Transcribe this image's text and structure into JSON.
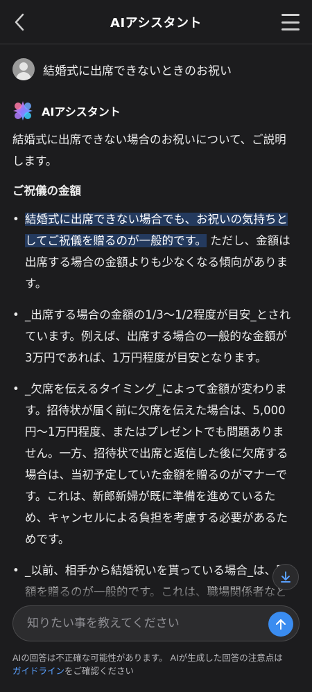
{
  "header": {
    "title": "AIアシスタント",
    "back_icon": "chevron-left-icon",
    "menu_icon": "hamburger-menu-icon"
  },
  "user": {
    "message": "結婚式に出席できないときのお祝い"
  },
  "assistant": {
    "name": "AIアシスタント",
    "intro": "結婚式に出席できない場合のお祝いについて、ご説明します。",
    "section_title": "ご祝儀の金額",
    "bullets": [
      {
        "highlighted": "結婚式に出席できない場合でも、お祝いの気持ちとしてご祝儀を贈るのが一般的です。",
        "rest": " ただし、金額は出席する場合の金額よりも少なくなる傾向があります。"
      },
      {
        "text": "_出席する場合の金額の1/3〜1/2程度が目安_とされています。例えば、出席する場合の一般的な金額が3万円であれば、1万円程度が目安となります。"
      },
      {
        "text": "_欠席を伝えるタイミング_によって金額が変わります。招待状が届く前に欠席を伝えた場合は、5,000円〜1万円程度、またはプレゼントでも問題ありません。一方、招待状で出席と返信した後に欠席する場合は、当初予定していた金額を贈るのがマナーです。これは、新郎新婦が既に準備を進めているため、キャンセルによる負担を考慮する必要があるためです。"
      },
      {
        "text": "_以前、相手から結婚祝いを貰っている場合_は、同額を贈るのが一般的です。これは、職場関係者などでも同様です。"
      }
    ]
  },
  "input": {
    "placeholder": "知りたい事を教えてください",
    "value": ""
  },
  "disclaimer": {
    "text_before": "AIの回答は不正確な可能性があります。 AIが生成した回答の注意点は",
    "link": "ガイドライン",
    "text_after": "をご確認ください"
  },
  "colors": {
    "background": "#1c1c1e",
    "accent": "#3a8cf0",
    "highlight": "#243a5e",
    "link": "#5aa0ff"
  }
}
